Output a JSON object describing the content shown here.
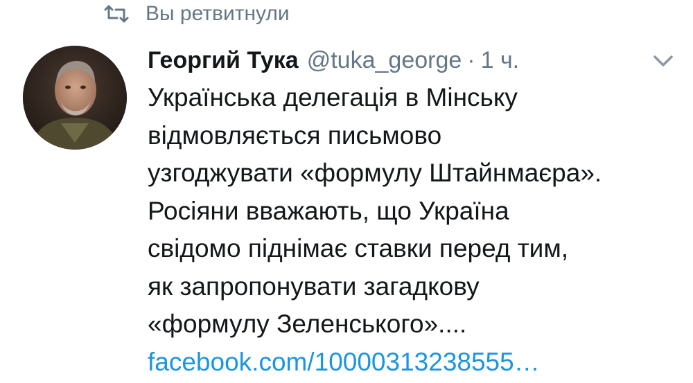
{
  "retweet": {
    "icon": "retweet-icon",
    "label": "Вы ретвитнули"
  },
  "tweet": {
    "avatar": "avatar-photo",
    "display_name": "Георгий Тука",
    "handle": "@tuka_george",
    "separator": "·",
    "time": "1 ч.",
    "menu_icon": "chevron-down-icon",
    "text_lines": [
      "Українська делегація в Мінську",
      "відмовляється письмово",
      "узгоджувати «формулу Штайнмаєра».",
      "Росіяни вважають, що Україна",
      "свідомо піднімає ставки перед тим,",
      "як запропонувати загадкову",
      "«формулу Зеленського»...."
    ],
    "link": "facebook.com/10000313238555…"
  },
  "colors": {
    "text": "#14171a",
    "secondary": "#657786",
    "link": "#1b95e0",
    "background": "#ffffff"
  }
}
